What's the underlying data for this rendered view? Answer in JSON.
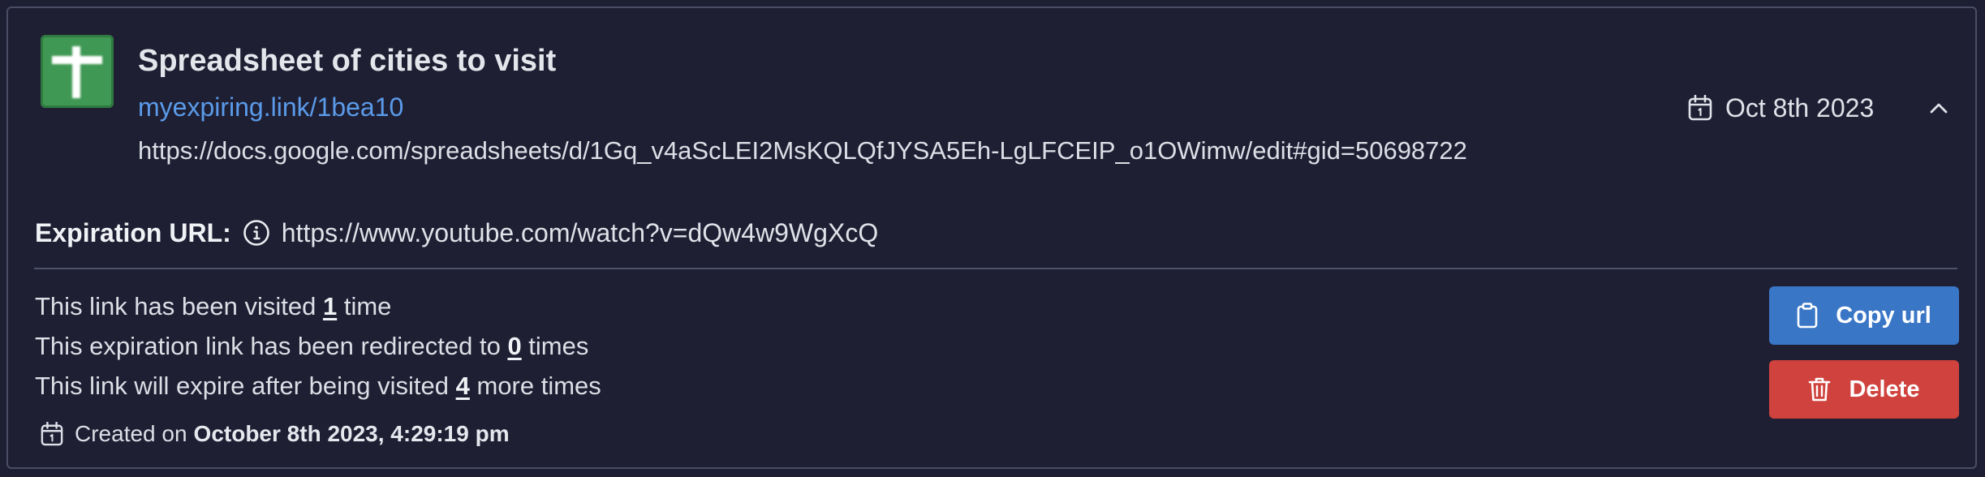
{
  "link": {
    "title": "Spreadsheet of cities to visit",
    "short_url": "myexpiring.link/1bea10",
    "destination_url": "https://docs.google.com/spreadsheets/d/1Gq_v4aScLEI2MsKQLQfJYSA5Eh-LgLFCEIP_o1OWimw/edit#gid=50698722",
    "favicon": "google-sheets-icon",
    "date": "Oct 8th 2023"
  },
  "expiration": {
    "label": "Expiration URL:",
    "url": "https://www.youtube.com/watch?v=dQw4w9WgXcQ"
  },
  "stats": {
    "visited_prefix": "This link has been visited ",
    "visited_count": "1",
    "visited_suffix": " time",
    "redirected_prefix": "This expiration link has been redirected to ",
    "redirected_count": "0",
    "redirected_suffix": " times",
    "expire_prefix": "This link will expire after being visited ",
    "expire_count": "4",
    "expire_suffix": " more times"
  },
  "created": {
    "prefix": "Created on",
    "datetime": "October 8th 2023, 4:29:19 pm"
  },
  "actions": {
    "copy_label": "Copy url",
    "delete_label": "Delete"
  },
  "colors": {
    "background": "#1e1f33",
    "link": "#5b9bea",
    "copy_button": "#3a76c6",
    "delete_button": "#cf423d",
    "favicon": "#3f9853"
  }
}
